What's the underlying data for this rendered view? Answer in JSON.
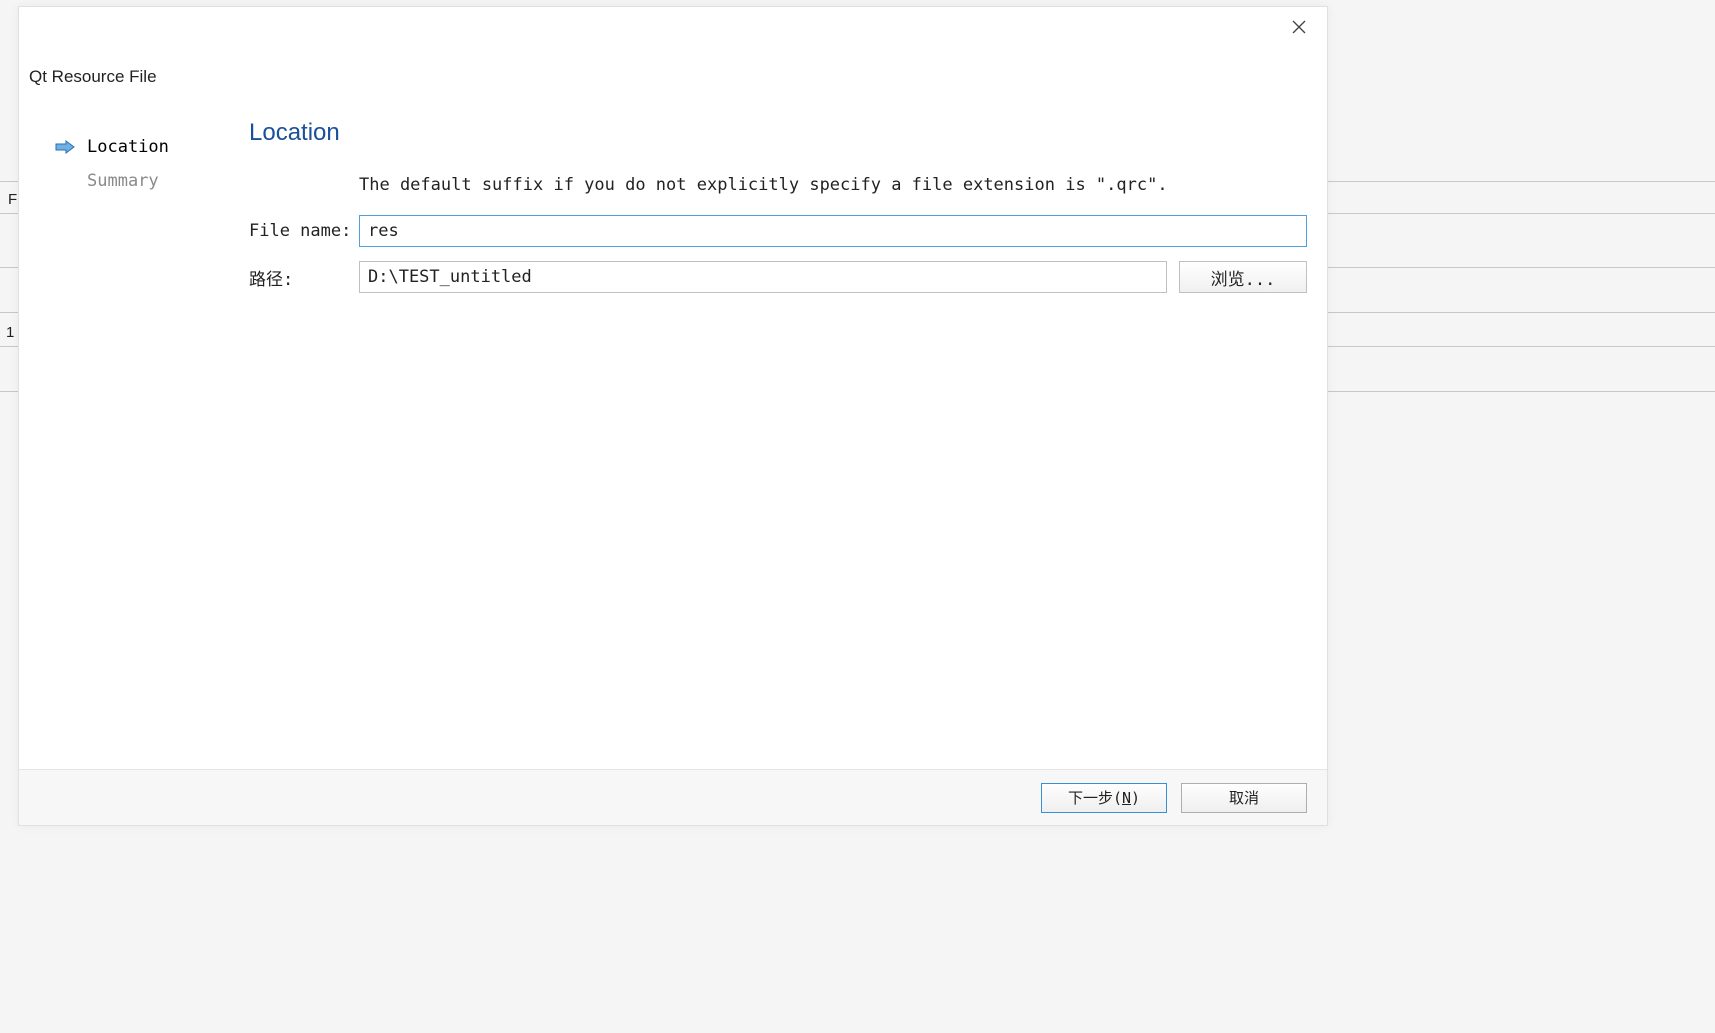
{
  "dialog": {
    "title": "Qt Resource File"
  },
  "sidebar": {
    "items": [
      {
        "label": "Location",
        "active": true
      },
      {
        "label": "Summary",
        "active": false
      }
    ]
  },
  "main": {
    "section_title": "Location",
    "description": "The default suffix if you do not explicitly specify a file extension is \".qrc\".",
    "filename_label": "File name:",
    "filename_value": "res",
    "path_label": "路径:",
    "path_value": "D:\\TEST_untitled",
    "browse_label": "浏览..."
  },
  "footer": {
    "next_label_prefix": "下一步(",
    "next_label_key": "N",
    "next_label_suffix": ")",
    "cancel_label": "取消"
  },
  "background": {
    "row_text": "1",
    "letter": "F"
  }
}
